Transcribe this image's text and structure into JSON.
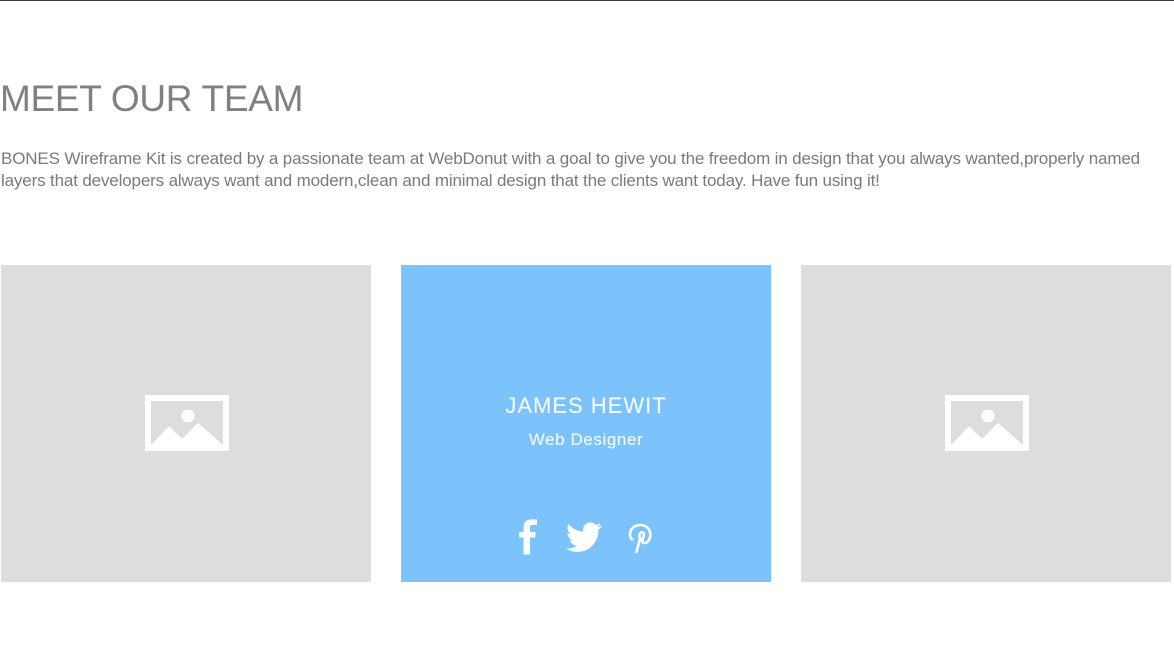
{
  "section": {
    "title": "MEET OUR TEAM",
    "description": "BONES Wireframe Kit is created by a passionate team at WebDonut with a goal to give you the freedom in design that you always wanted,properly named layers that developers always want and modern,clean and minimal design that the clients want today. Have fun using it!"
  },
  "team": {
    "cards": [
      {
        "type": "image-placeholder",
        "icon": "image-icon"
      },
      {
        "type": "member",
        "name": "JAMES HEWIT",
        "role": "Web Designer",
        "social": [
          "facebook-icon",
          "twitter-icon",
          "pinterest-icon"
        ]
      },
      {
        "type": "image-placeholder",
        "icon": "image-icon"
      }
    ]
  },
  "colors": {
    "placeholder_bg": "#dddddd",
    "featured_bg": "#7cc3fc",
    "heading_text": "#808080",
    "body_text": "#7a7a7a",
    "icon_white": "#ffffff"
  }
}
